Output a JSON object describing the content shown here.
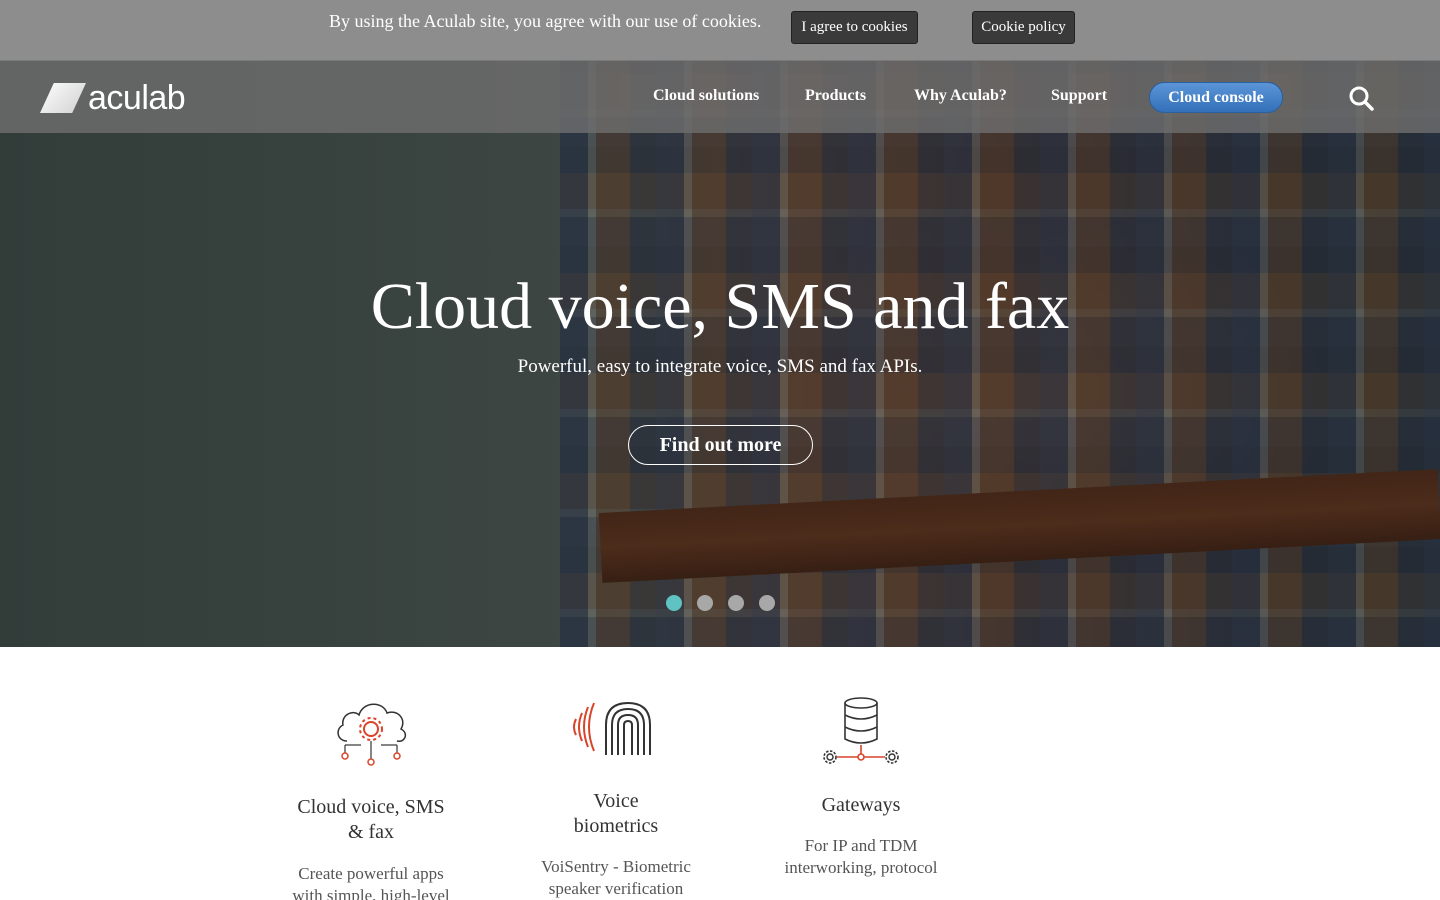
{
  "cookie": {
    "text": "By using the Aculab site, you agree with our use of cookies.",
    "agree_label": "I agree to cookies",
    "policy_label": "Cookie policy"
  },
  "nav": {
    "logo_text": "aculab",
    "items": [
      {
        "label": "Cloud solutions"
      },
      {
        "label": "Products"
      },
      {
        "label": "Why Aculab?"
      },
      {
        "label": "Support"
      }
    ],
    "console_label": "Cloud console",
    "search_icon": "search-icon",
    "console_color": "#3f7fc8"
  },
  "hero": {
    "title": "Cloud voice, SMS and fax",
    "subtitle": "Powerful, easy to integrate voice, SMS and fax APIs.",
    "button_label": "Find out more",
    "slide_count": 4,
    "active_slide": 1,
    "active_dot_color": "#5fc3c4"
  },
  "features": [
    {
      "icon": "cloud-gear-icon",
      "title_line1": "Cloud voice, SMS",
      "title_line2": "& fax",
      "desc_line1": "Create powerful apps",
      "desc_line2": "with simple, high-level"
    },
    {
      "icon": "fingerprint-icon",
      "title_line1": "Voice",
      "title_line2": "biometrics",
      "desc_line1": "VoiSentry - Biometric",
      "desc_line2": "speaker verification"
    },
    {
      "icon": "database-gears-icon",
      "title_line1": "Gateways",
      "title_line2": "",
      "desc_line1": "For IP and TDM",
      "desc_line2": "interworking, protocol"
    }
  ]
}
